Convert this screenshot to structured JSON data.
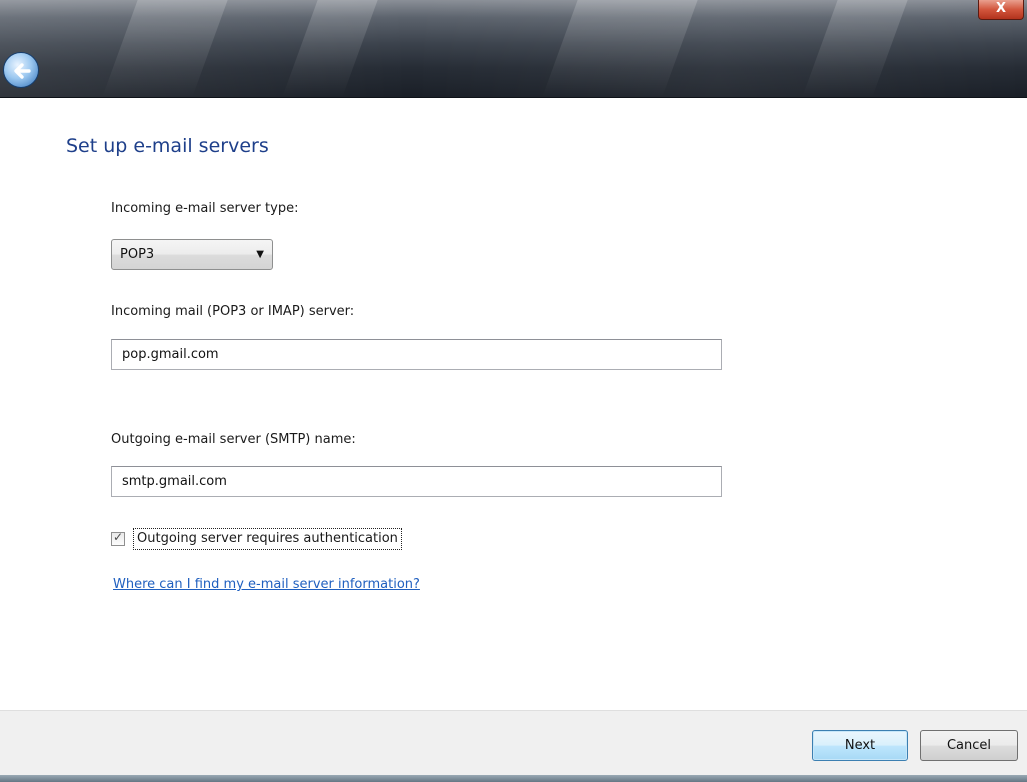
{
  "window": {
    "close_label": "X"
  },
  "heading": "Set up e-mail servers",
  "incoming_type": {
    "label": "Incoming e-mail server type:",
    "selected": "POP3"
  },
  "incoming_server": {
    "label": "Incoming mail (POP3 or IMAP) server:",
    "value": "pop.gmail.com"
  },
  "outgoing_server": {
    "label": "Outgoing e-mail server (SMTP) name:",
    "value": "smtp.gmail.com"
  },
  "auth_checkbox": {
    "label": "Outgoing server requires authentication",
    "checked": true
  },
  "help_link": "Where can I find my e-mail server information?",
  "buttons": {
    "next": "Next",
    "cancel": "Cancel"
  },
  "colors": {
    "heading": "#1e3f8a",
    "link": "#1f5fbf",
    "footer_bg": "#f0f0f0",
    "default_button_border": "#3c7fb1"
  },
  "icons": {
    "back": "back-arrow-icon",
    "dropdown": "chevron-down-icon",
    "check": "checkmark-icon"
  }
}
